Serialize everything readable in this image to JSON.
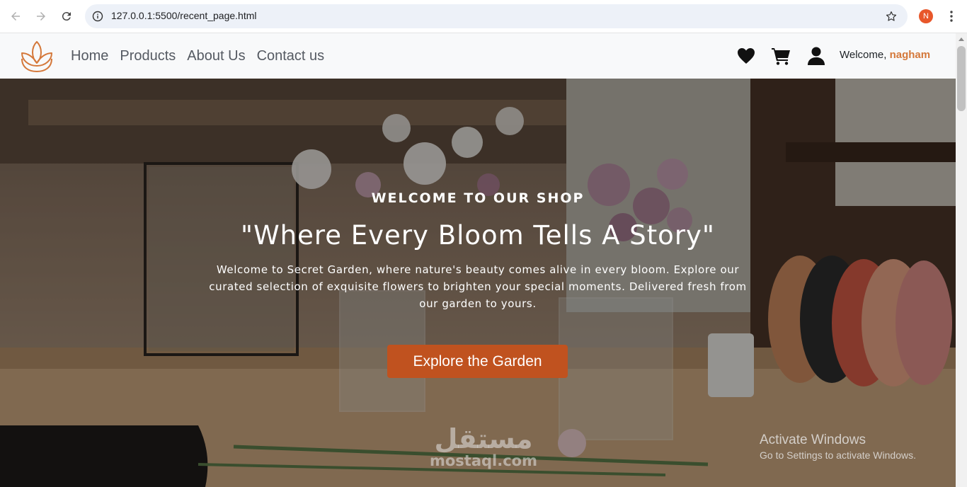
{
  "browser": {
    "url": "127.0.0.1:5500/recent_page.html",
    "profile_initial": "N"
  },
  "header": {
    "nav": [
      "Home",
      "Products",
      "About Us",
      "Contact us"
    ],
    "welcome_prefix": "Welcome, ",
    "username": "nagham",
    "icons": [
      "logo-lotus-icon",
      "heart-icon",
      "cart-icon",
      "user-icon"
    ]
  },
  "hero": {
    "eyebrow": "WELCOME TO OUR SHOP",
    "headline": "\"Where Every Bloom Tells A Story\"",
    "subtext": "Welcome to Secret Garden, where nature's beauty comes alive in every bloom. Explore our curated selection of exquisite flowers to brighten your special moments. Delivered fresh from our garden to yours.",
    "cta": "Explore the Garden"
  },
  "overlay": {
    "watermark_ar": "مستقل",
    "watermark_en": "mostaql.com",
    "activate_title": "Activate Windows",
    "activate_sub": "Go to Settings to activate Windows."
  },
  "colors": {
    "accent": "#c0521f",
    "logo": "#d4783a",
    "username": "#d4783a",
    "header_bg": "#f8f9fa"
  }
}
